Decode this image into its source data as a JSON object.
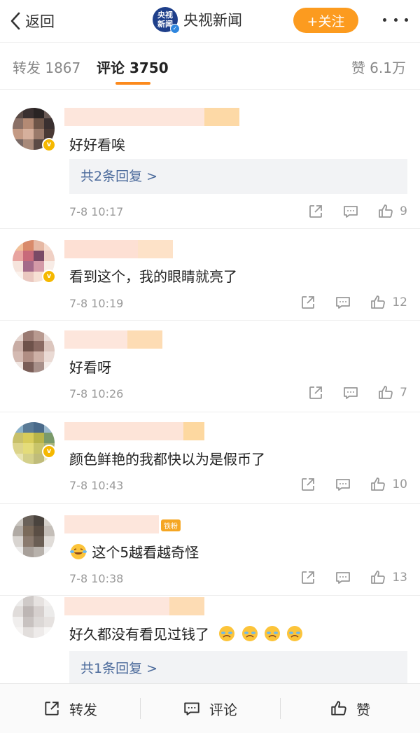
{
  "header": {
    "back_label": "返回",
    "logo_line1": "央视",
    "logo_line2": "新闻",
    "account_name": "央视新闻",
    "follow_label": "+关注"
  },
  "tabs": {
    "repost": "转发 1867",
    "comment": "评论 3750",
    "like": "赞 6.1万"
  },
  "comments": [
    {
      "text": "好好看唉",
      "reply": "共2条回复 >",
      "time": "7-8 10:17",
      "likes": "9"
    },
    {
      "text": "看到这个，我的眼睛就亮了",
      "time": "7-8 10:19",
      "likes": "12"
    },
    {
      "text": "好看呀",
      "time": "7-8 10:26",
      "likes": "7"
    },
    {
      "text": "颜色鲜艳的我都快以为是假币了",
      "time": "7-8 10:43",
      "likes": "10"
    },
    {
      "text": "这个5越看越奇怪",
      "badge": "铁粉",
      "time": "7-8 10:38",
      "likes": "13"
    },
    {
      "text": "好久都没有看见过钱了",
      "reply": "共1条回复 >",
      "time": "",
      "likes": ""
    }
  ],
  "bottom_bar": {
    "repost": "转发",
    "comment": "评论",
    "like": "赞"
  },
  "colors": {
    "accent_orange": "#fc9b1f",
    "link_blue": "#4b6a9b",
    "verified_badge": "#f5b800"
  }
}
